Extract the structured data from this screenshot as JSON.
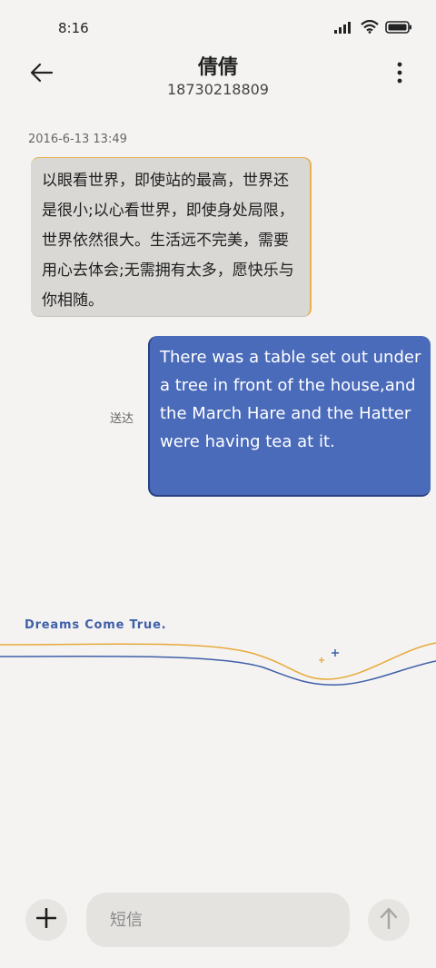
{
  "status_bar": {
    "time": "8:16",
    "signal_icon": "signal-icon",
    "wifi_icon": "wifi-icon",
    "battery_icon": "battery-icon"
  },
  "header": {
    "back_icon": "back-arrow-icon",
    "contact_name": "倩倩",
    "contact_number": "18730218809",
    "menu_icon": "more-vertical-icon"
  },
  "conversation": {
    "timestamp": "2016-6-13 13:49",
    "incoming_message": "以眼看世界，即使站的最高，世界还是很小;以心看世界，即使身处局限，世界依然很大。生活远不完美，需要用心去体会;无需拥有太多，愿快乐与你相随。",
    "outgoing_message": "There was a table set out under a tree in front of the house,and the March Hare and the Hatter were having tea at it.",
    "delivery_status": "送达"
  },
  "decoration": {
    "tagline": "Dreams Come True.",
    "colors": {
      "gold": "#e7a93a",
      "blue": "#3f5fa9"
    }
  },
  "composer": {
    "add_icon": "plus-icon",
    "input_placeholder": "短信",
    "input_value": "",
    "send_icon": "send-arrow-icon"
  },
  "colors": {
    "background": "#f4f3f1",
    "incoming_bubble": "#d9d8d5",
    "outgoing_bubble": "#4a6aba",
    "accent_gold": "#e7b24c"
  }
}
